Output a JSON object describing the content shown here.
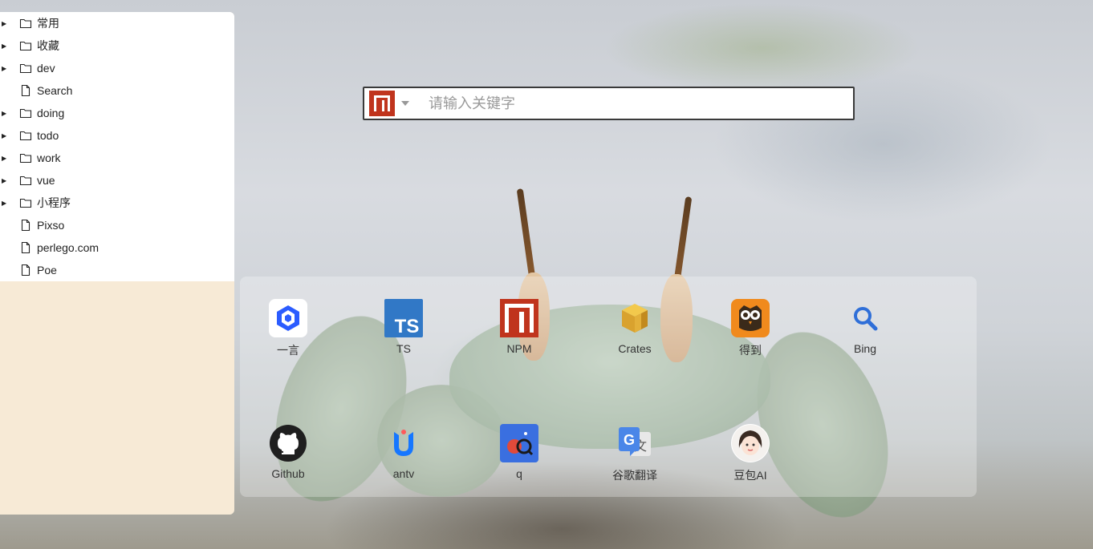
{
  "bookmarks": {
    "items": [
      {
        "label": "常用",
        "type": "folder"
      },
      {
        "label": "收藏",
        "type": "folder"
      },
      {
        "label": "dev",
        "type": "folder"
      },
      {
        "label": "Search",
        "type": "file"
      },
      {
        "label": "doing",
        "type": "folder"
      },
      {
        "label": "todo",
        "type": "folder"
      },
      {
        "label": "work",
        "type": "folder"
      },
      {
        "label": "vue",
        "type": "folder"
      },
      {
        "label": "小程序",
        "type": "folder"
      },
      {
        "label": "Pixso",
        "type": "file"
      },
      {
        "label": "perlego.com",
        "type": "file"
      },
      {
        "label": "Poe",
        "type": "file"
      }
    ]
  },
  "search": {
    "engine_icon": "npm-logo-icon",
    "placeholder": "请输入关键字",
    "value": ""
  },
  "shortcuts": [
    {
      "label": "一言",
      "icon": "yiyan-cube-icon"
    },
    {
      "label": "TS",
      "icon": "typescript-icon"
    },
    {
      "label": "NPM",
      "icon": "npm-icon"
    },
    {
      "label": "Crates",
      "icon": "crates-icon"
    },
    {
      "label": "得到",
      "icon": "dedao-owl-icon"
    },
    {
      "label": "Bing",
      "icon": "magnifier-icon"
    },
    {
      "label": "Github",
      "icon": "github-icon"
    },
    {
      "label": "antv",
      "icon": "antv-icon"
    },
    {
      "label": "q",
      "icon": "q-icon"
    },
    {
      "label": "谷歌翻译",
      "icon": "google-translate-icon"
    },
    {
      "label": "豆包AI",
      "icon": "doubao-avatar-icon"
    }
  ],
  "colors": {
    "sidebar_bg": "#f7ead6",
    "npm_red": "#c0341d",
    "ts_blue": "#3178c6"
  }
}
